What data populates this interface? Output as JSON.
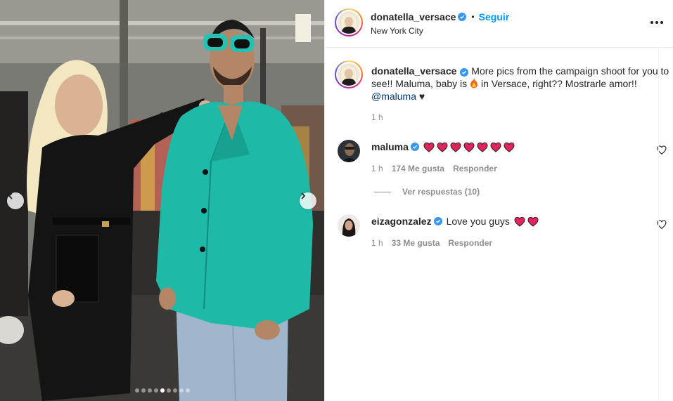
{
  "post": {
    "username": "donatella_versace",
    "separator": "•",
    "follow_label": "Seguir",
    "location": "New York City",
    "more_icon": "more-horizontal-icon",
    "carousel": {
      "total_slides": 9,
      "active_index": 4,
      "prev_icon": "chevron-left-icon",
      "next_icon": "chevron-right-icon"
    }
  },
  "caption": {
    "username": "donatella_versace",
    "text_before_emoji": "More pics from the campaign shoot for you to see!! Maluma, baby is",
    "emoji": "fire-emoji",
    "text_after_emoji": "in Versace, right?? Mostrarle amor!!",
    "mention": "@maluma",
    "trailing_symbol": "♥",
    "time": "1 h"
  },
  "comments": [
    {
      "username": "maluma",
      "verified": true,
      "hearts": 7,
      "text": "",
      "time": "1 h",
      "likes": "174 Me gusta",
      "reply_label": "Responder",
      "view_replies": "Ver respuestas (10)"
    },
    {
      "username": "eizagonzalez",
      "verified": true,
      "hearts": 2,
      "text": "Love you guys",
      "time": "1 h",
      "likes": "33 Me gusta",
      "reply_label": "Responder"
    }
  ],
  "colors": {
    "link_blue": "#0095f6",
    "verified_blue": "#3897f0",
    "heart_red": "#e0245e",
    "secondary_text": "#8e8e8e",
    "jacket_teal": "#1fb9a8"
  }
}
